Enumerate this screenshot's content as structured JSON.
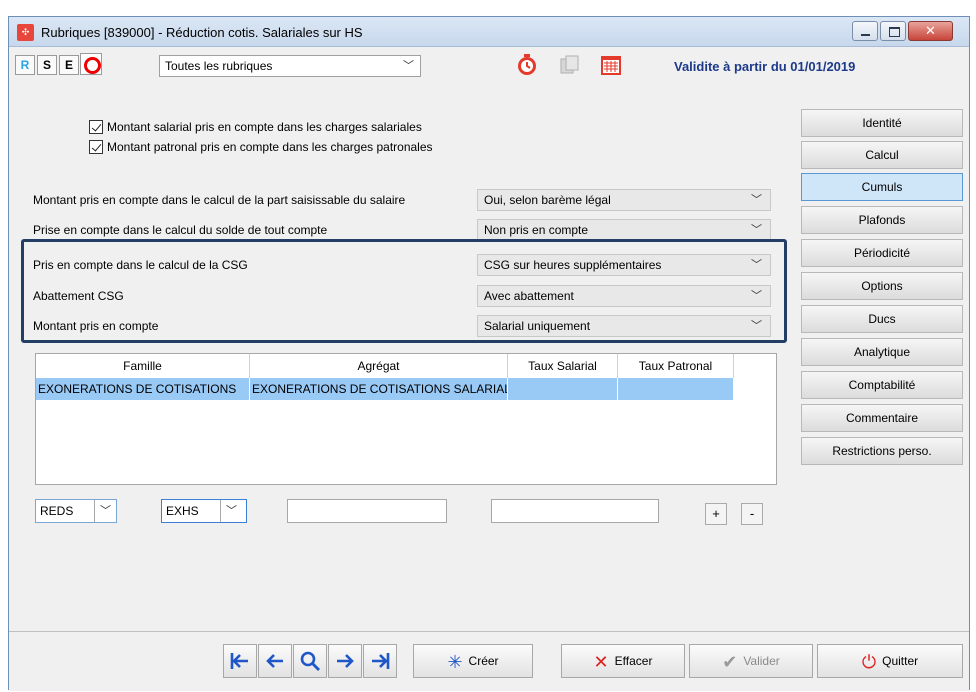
{
  "window": {
    "title": "Rubriques [839000] - Réduction cotis. Salariales sur HS",
    "app_icon_glyph": "✣"
  },
  "toolbar": {
    "letters": [
      "R",
      "S",
      "E"
    ],
    "filter_value": "Toutes les rubriques",
    "validite": "Validite à partir du 01/01/2019"
  },
  "checkboxes": [
    {
      "label": "Montant salarial pris en compte dans les charges salariales",
      "checked": true
    },
    {
      "label": "Montant patronal pris en compte dans les charges patronales",
      "checked": true
    }
  ],
  "fields": [
    {
      "label": "Montant pris en compte dans le calcul de la part saisissable du salaire",
      "value": "Oui, selon barème légal"
    },
    {
      "label": "Prise en compte dans le calcul du solde de tout compte",
      "value": "Non pris en compte"
    },
    {
      "label": "Pris en compte dans le calcul de la CSG",
      "value": "CSG sur heures supplémentaires"
    },
    {
      "label": "Abattement CSG",
      "value": "Avec abattement"
    },
    {
      "label": "Montant pris en compte",
      "value": "Salarial uniquement"
    }
  ],
  "side_buttons": [
    {
      "label": "Identité",
      "active": false
    },
    {
      "label": "Calcul",
      "active": false
    },
    {
      "label": "Cumuls",
      "active": true
    },
    {
      "label": "Plafonds",
      "active": false
    },
    {
      "label": "Périodicité",
      "active": false
    },
    {
      "label": "Options",
      "active": false
    },
    {
      "label": "Ducs",
      "active": false
    },
    {
      "label": "Analytique",
      "active": false
    },
    {
      "label": "Comptabilité",
      "active": false
    },
    {
      "label": "Commentaire",
      "active": false
    },
    {
      "label": "Restrictions perso.",
      "active": false
    }
  ],
  "grid": {
    "columns": [
      "Famille",
      "Agrégat",
      "Taux Salarial",
      "Taux Patronal"
    ],
    "rows": [
      [
        "EXONERATIONS DE COTISATIONS",
        "EXONERATIONS DE COTISATIONS SALARIALES",
        "",
        ""
      ]
    ]
  },
  "editor": {
    "famille_code": "REDS",
    "agregat_code": "EXHS",
    "taux_salarial": "",
    "taux_patronal": "",
    "plus_label": "+",
    "minus_label": "-"
  },
  "bottom": {
    "nav": [
      "|←",
      "←",
      "search",
      "→",
      "→|"
    ],
    "creer": "Créer",
    "effacer": "Effacer",
    "valider": "Valider",
    "quitter": "Quitter"
  },
  "colors": {
    "accent_blue": "#1f56c8",
    "highlight_border": "#233f66",
    "selected_row": "#99c9f5",
    "validite_text": "#1d3a8a"
  }
}
